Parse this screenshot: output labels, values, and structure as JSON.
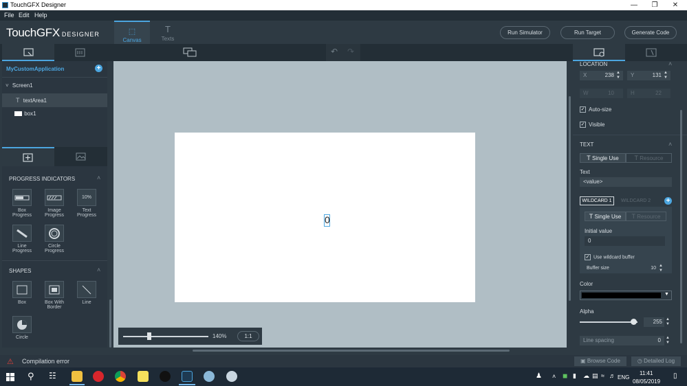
{
  "window": {
    "title": "TouchGFX Designer"
  },
  "menu": [
    "File",
    "Edit",
    "Help"
  ],
  "brand": {
    "main": "TouchGFX",
    "sub": "DESIGNER"
  },
  "tabs": [
    {
      "label": "Canvas"
    },
    {
      "label": "Texts"
    }
  ],
  "actions": {
    "run_simulator": "Run Simulator",
    "run_target": "Run Target",
    "generate_code": "Generate Code"
  },
  "tree": {
    "app": "MyCustomApplication",
    "screen": "Screen1",
    "items": [
      "textArea1",
      "box1"
    ]
  },
  "widgets": {
    "progress_title": "PROGRESS INDICATORS",
    "progress": [
      "Box Progress",
      "Image Progress",
      "Text Progress",
      "Line Progress",
      "Circle Progress"
    ],
    "progress_text_badge": "10%",
    "shapes_title": "SHAPES",
    "shapes": [
      "Box",
      "Box With Border",
      "Line",
      "Circle"
    ]
  },
  "canvas": {
    "text_value": "0",
    "zoom": "140%",
    "ratio": "1:1",
    "zoom_fraction": 0.3
  },
  "props": {
    "location_title": "LOCATION",
    "x_label": "X",
    "x": "238",
    "y_label": "Y",
    "y": "131",
    "w_label": "W",
    "w": "10",
    "h_label": "H",
    "h": "22",
    "autosize": "Auto-size",
    "visible": "Visible",
    "text_title": "TEXT",
    "single_use": "Single Use",
    "resource": "Resource",
    "text_label": "Text",
    "text_value": "<value>",
    "wildcard1": "WILDCARD 1",
    "wildcard2": "WILDCARD 2",
    "initial_value_label": "Initial value",
    "initial_value": "0",
    "use_buffer": "Use wildcard buffer",
    "buffer_size_label": "Buffer size",
    "buffer_size": "10",
    "color_label": "Color",
    "color": "#000000",
    "alpha_label": "Alpha",
    "alpha": "255",
    "alpha_fraction": 0.95,
    "line_spacing_label": "Line spacing",
    "line_spacing": "0"
  },
  "status": {
    "error": "Compilation error",
    "browse_code": "Browse Code",
    "detailed_log": "Detailed Log"
  },
  "taskbar": {
    "lang": "ENG",
    "time": "11:41",
    "date": "08/05/2019"
  },
  "colors": {
    "accent": "#4ca6e0",
    "error": "#e0413b"
  }
}
